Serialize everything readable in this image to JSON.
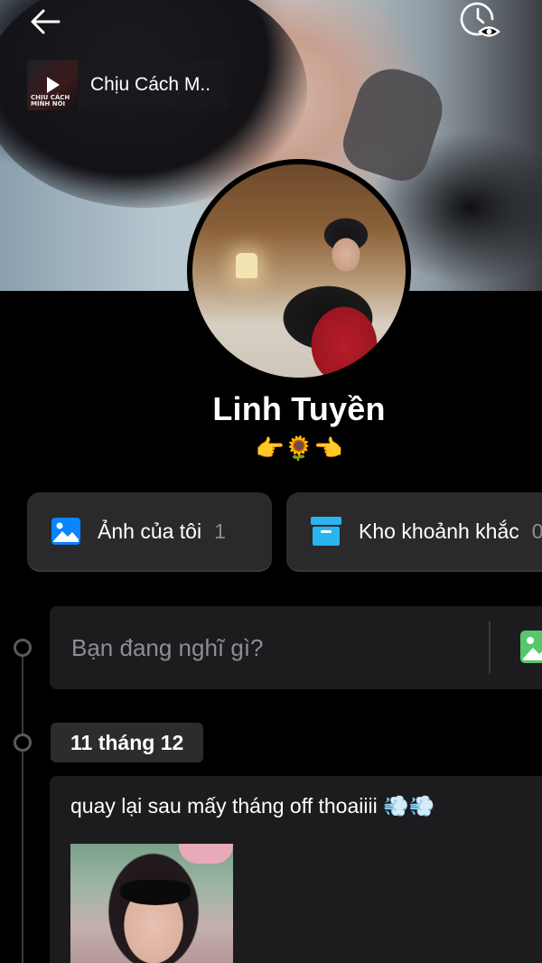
{
  "cover": {
    "music": {
      "title": "Chịu Cách M..",
      "thumb_caption": "CHỊU CÁCH MÌNH NÓI"
    }
  },
  "profile": {
    "name": "Linh Tuyền",
    "bio": "👉🌻👈"
  },
  "actions": [
    {
      "label": "Ảnh của tôi",
      "count": "1",
      "icon": "photo-icon",
      "color": "#0a84ff"
    },
    {
      "label": "Kho khoảnh khắc",
      "count": "0",
      "icon": "archive-box-icon",
      "color": "#2ab4f0"
    }
  ],
  "composer": {
    "placeholder": "Bạn đang nghĩ gì?"
  },
  "timeline": {
    "date": "11 tháng 12",
    "post": {
      "text": "quay lại sau mấy tháng off thoaiiii 💨💨"
    }
  },
  "colors": {
    "accent_green": "#56c76a",
    "card_bg": "#2a2a2c"
  }
}
